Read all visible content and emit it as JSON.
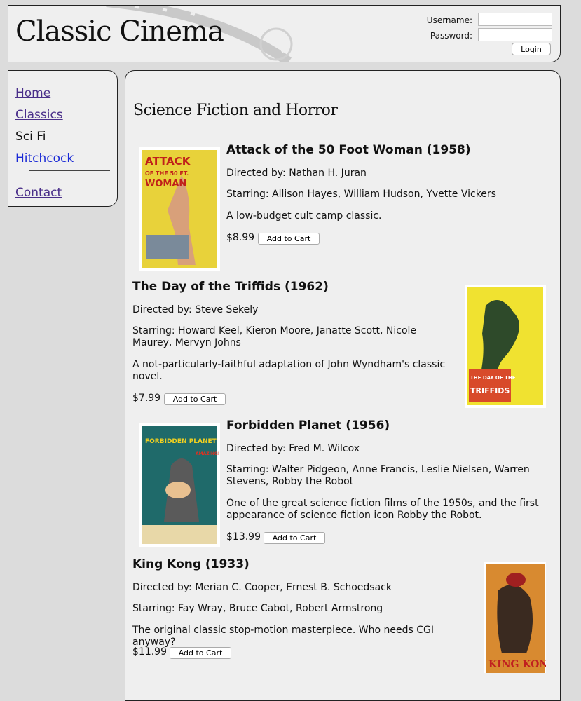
{
  "header": {
    "logo": "Classic Cinema",
    "username_label": "Username:",
    "password_label": "Password:",
    "login_button": "Login"
  },
  "nav": {
    "home": "Home",
    "classics": "Classics",
    "scifi": "Sci Fi",
    "hitchcock": "Hitchcock",
    "contact": "Contact"
  },
  "main": {
    "title": "Science Fiction and Horror",
    "add_to_cart": "Add to Cart",
    "movies": [
      {
        "title": "Attack of the 50 Foot Woman (1958)",
        "director": "Directed by: Nathan H. Juran",
        "starring": "Starring: Allison Hayes, William Hudson, Yvette Vickers",
        "description": "A low-budget cult camp classic.",
        "price": "$8.99",
        "poster_text": [
          "ATTACK",
          "OF THE 50 FT.",
          "WOMAN"
        ]
      },
      {
        "title": "The Day of the Triffids (1962)",
        "director": "Directed by: Steve Sekely",
        "starring": "Starring: Howard Keel, Kieron Moore, Janatte Scott, Nicole Maurey, Mervyn Johns",
        "description": "A not-particularly-faithful adaptation of John Wyndham's classic novel.",
        "price": "$7.99",
        "poster_text": [
          "THE DAY OF THE",
          "TRIFFIDS"
        ]
      },
      {
        "title": "Forbidden Planet (1956)",
        "director": "Directed by: Fred M. Wilcox",
        "starring": "Starring: Walter Pidgeon, Anne Francis, Leslie Nielsen, Warren Stevens, Robby the Robot",
        "description": "One of the great science fiction films of the 1950s, and the first appearance of science fiction icon Robby the Robot.",
        "price": "$13.99",
        "poster_text": [
          "FORBIDDEN PLANET",
          "AMAZING!"
        ]
      },
      {
        "title": "King Kong (1933)",
        "director": "Directed by: Merian C. Cooper, Ernest B. Schoedsack",
        "starring": "Starring: Fay Wray, Bruce Cabot, Robert Armstrong",
        "description": "The original classic stop-motion masterpiece. Who needs CGI anyway?",
        "price": "$11.99",
        "poster_text": [
          "KING KONG"
        ]
      }
    ]
  },
  "colors": {
    "page_bg": "#dcdcdc",
    "panel_bg": "#efefef",
    "link_visited": "#4a2f8a",
    "link": "#1a2ad6"
  }
}
